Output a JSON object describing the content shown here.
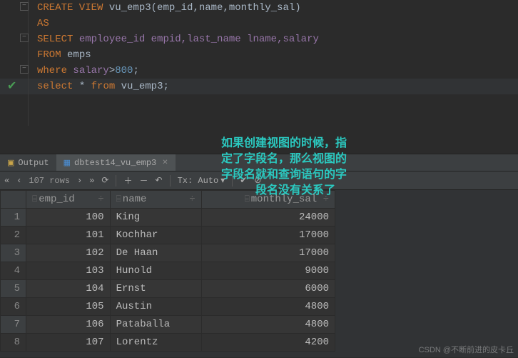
{
  "code": {
    "l1a": "CREATE VIEW",
    "l1b": "vu_emp3",
    "l1c": "(emp_id,name,monthly_sal)",
    "l2": "AS",
    "l3a": "SELECT",
    "l3b": "employee_id empid,last_name lname,salary",
    "l4a": "FROM",
    "l4b": "emps",
    "l5a": "where",
    "l5b": "salary",
    "l5c": ">",
    "l5d": "800",
    "l5e": ";",
    "l6a": "select",
    "l6b": "*",
    "l6c": "from",
    "l6d": "vu_emp3",
    "l6e": ";"
  },
  "overlay": {
    "t1": "如果创建视图的时候，指",
    "t2": "定了字段名，那么视图的",
    "t3": "字段名就和查询语句的字",
    "t4": "段名没有关系了"
  },
  "tabs": {
    "output": "Output",
    "result": "dbtest14_vu_emp3"
  },
  "toolbar": {
    "rows": "107 rows",
    "tx": "Tx: Auto"
  },
  "table": {
    "h1": "emp_id",
    "h2": "name",
    "h3": "monthly_sal",
    "sort": "÷",
    "rows": [
      {
        "n": "1",
        "id": "100",
        "name": "King",
        "sal": "24000"
      },
      {
        "n": "2",
        "id": "101",
        "name": "Kochhar",
        "sal": "17000"
      },
      {
        "n": "3",
        "id": "102",
        "name": "De Haan",
        "sal": "17000"
      },
      {
        "n": "4",
        "id": "103",
        "name": "Hunold",
        "sal": "9000"
      },
      {
        "n": "5",
        "id": "104",
        "name": "Ernst",
        "sal": "6000"
      },
      {
        "n": "6",
        "id": "105",
        "name": "Austin",
        "sal": "4800"
      },
      {
        "n": "7",
        "id": "106",
        "name": "Pataballa",
        "sal": "4800"
      },
      {
        "n": "8",
        "id": "107",
        "name": "Lorentz",
        "sal": "4200"
      }
    ]
  },
  "watermark": "CSDN @不断前进的皮卡丘"
}
